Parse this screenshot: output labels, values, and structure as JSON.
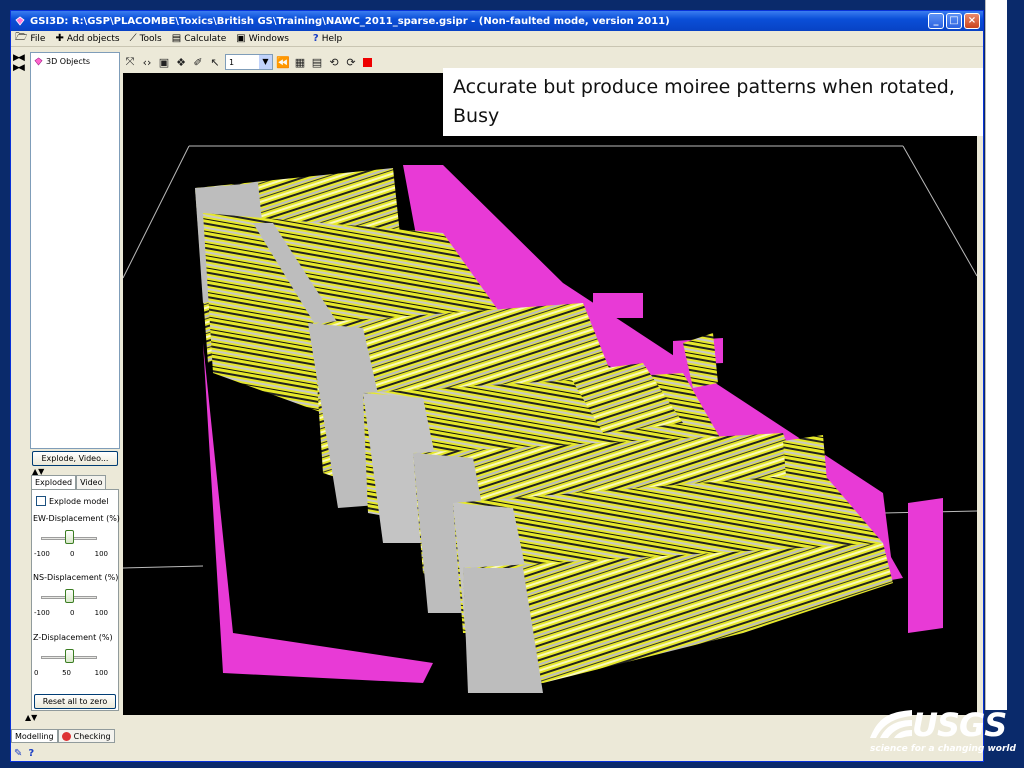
{
  "window": {
    "title": "GSI3D: R:\\GSP\\PLACOMBE\\Toxics\\British GS\\Training\\NAWC_2011_sparse.gsipr - (Non-faulted mode, version 2011)"
  },
  "menu": [
    {
      "label": "File",
      "icon": "folder-icon"
    },
    {
      "label": "Add objects",
      "icon": "plus-icon"
    },
    {
      "label": "Tools",
      "icon": "tools-icon"
    },
    {
      "label": "Calculate",
      "icon": "calculator-icon"
    },
    {
      "label": "Windows",
      "icon": "windows-icon"
    },
    {
      "label": "Help",
      "icon": "help-icon"
    }
  ],
  "tree": {
    "root_label": "3D Objects"
  },
  "explode_button_label": "Explode, Video...",
  "tabs": [
    {
      "label": "Exploded"
    },
    {
      "label": "Video"
    }
  ],
  "panel": {
    "explode_checkbox_label": "Explode model",
    "explode_checked": false,
    "sliders": [
      {
        "label": "EW-Displacement (%)",
        "min": "-100",
        "mid": "0",
        "max": "100",
        "value": 0
      },
      {
        "label": "NS-Displacement (%)",
        "min": "-100",
        "mid": "0",
        "max": "100",
        "value": 0
      },
      {
        "label": "Z-Displacement (%)",
        "min": "0",
        "mid": "50",
        "max": "100",
        "value": 50
      }
    ],
    "reset_label": "Reset all to zero"
  },
  "bottom_tabs": [
    {
      "label": "Modelling"
    },
    {
      "label": "Checking"
    }
  ],
  "viewer": {
    "level_value": "1"
  },
  "caption": {
    "line1": "Accurate but produce moiree patterns when rotated,",
    "line2": "Busy"
  },
  "logo": {
    "word": "USGS",
    "tagline": "science for a changing world"
  },
  "colors": {
    "section_fill": "#e6e82a",
    "section_grey": "#bdbdbd",
    "surface_magenta": "#e83ad6",
    "viewport_bg": "#000000"
  }
}
